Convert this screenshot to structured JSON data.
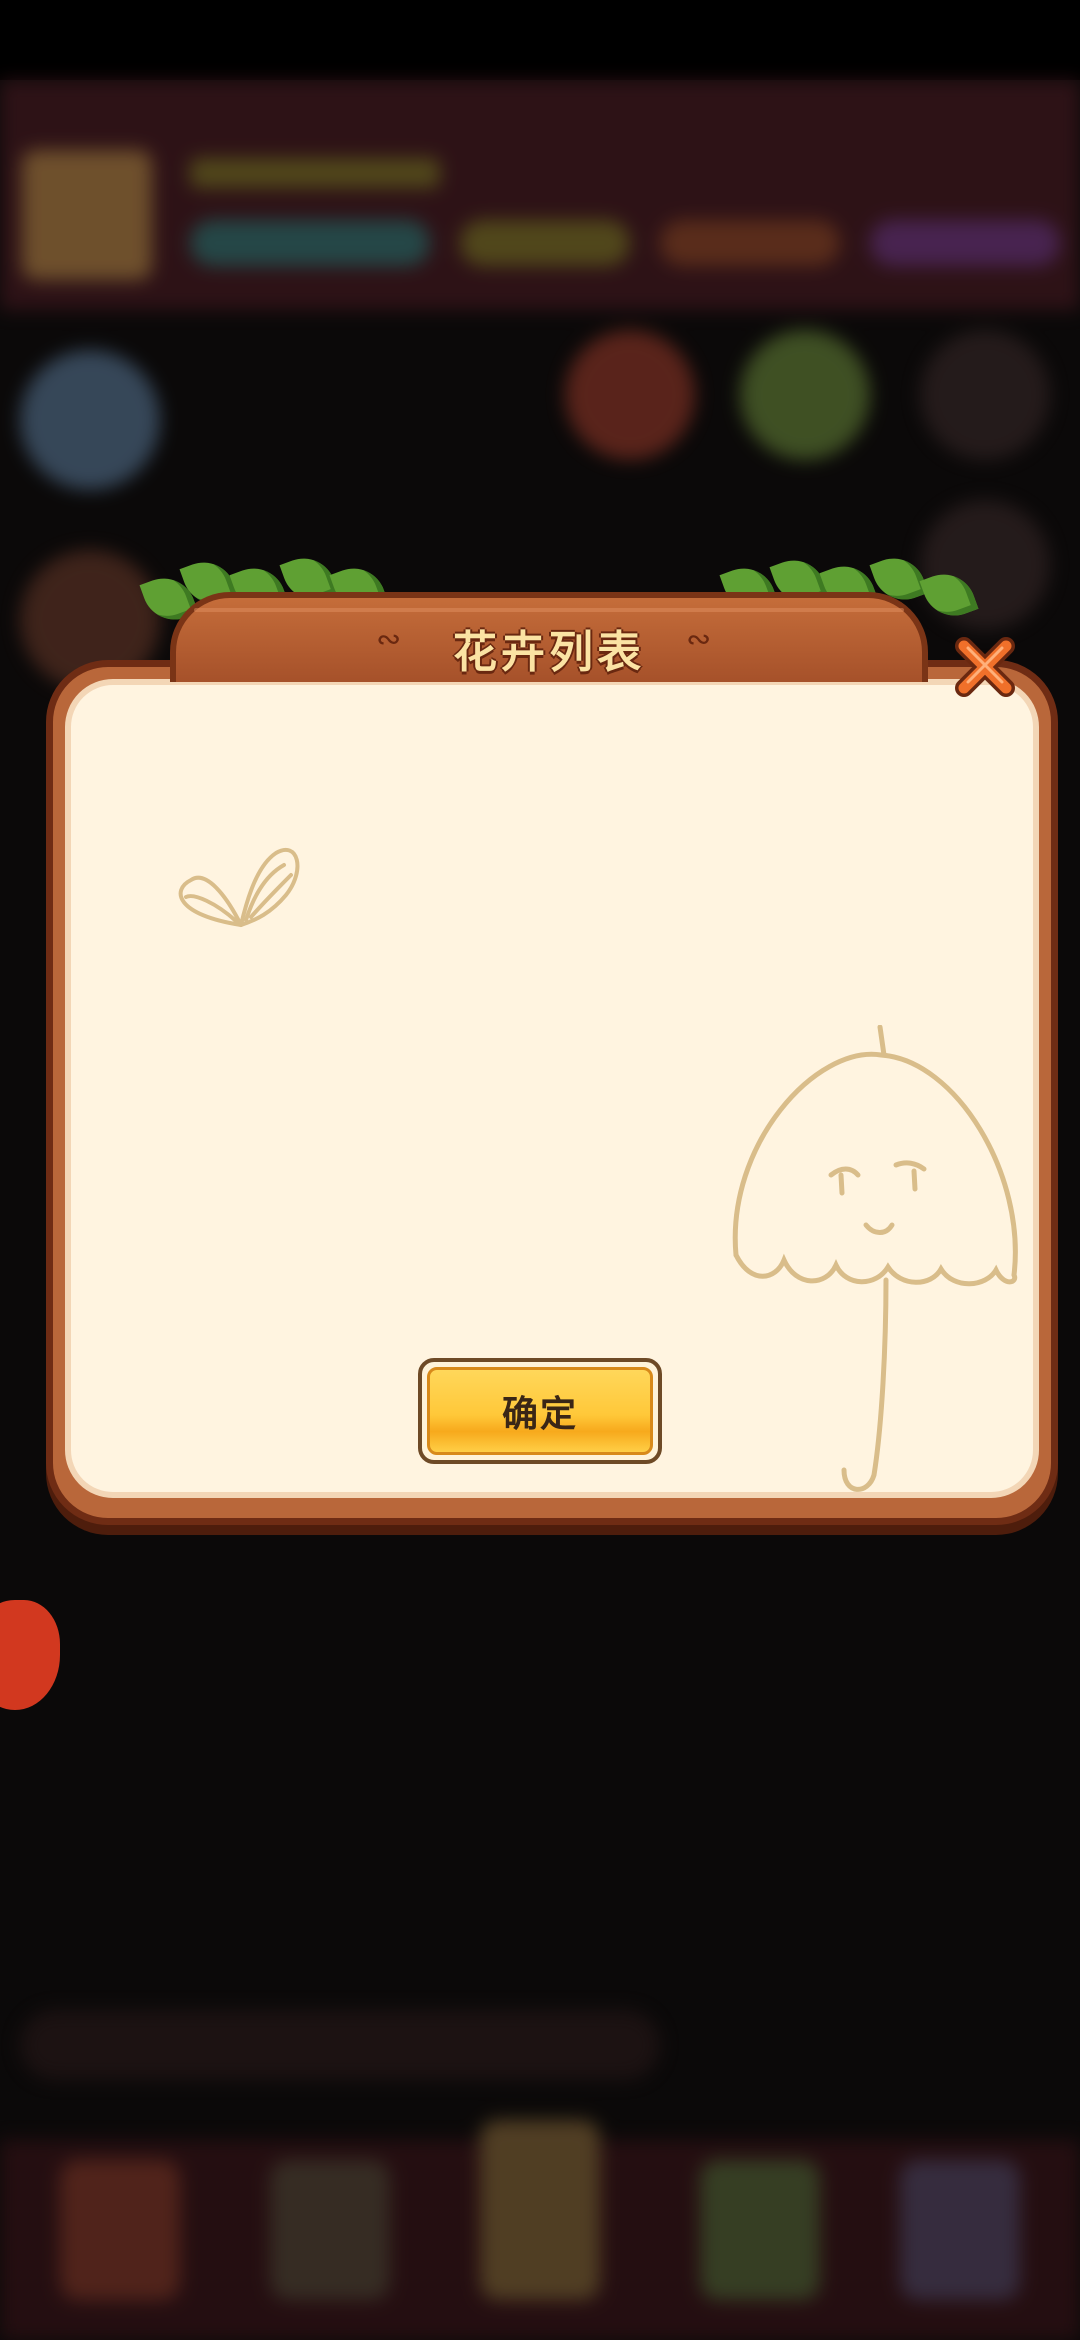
{
  "dialog": {
    "title": "花卉列表",
    "confirm_label": "确定"
  },
  "icons": {
    "close": "close-x-icon",
    "heart": "heart-doodle-icon",
    "umbrella": "umbrella-doodle-icon",
    "title_ornament": "scroll-ornament-icon"
  },
  "colors": {
    "dialog_frame": "#b9673a",
    "dialog_inner": "#fff4e0",
    "title_text": "#fbe3a3",
    "confirm_button": "#ffc839",
    "close_icon": "#f0702a",
    "doodle_stroke": "#d9bd8a"
  }
}
